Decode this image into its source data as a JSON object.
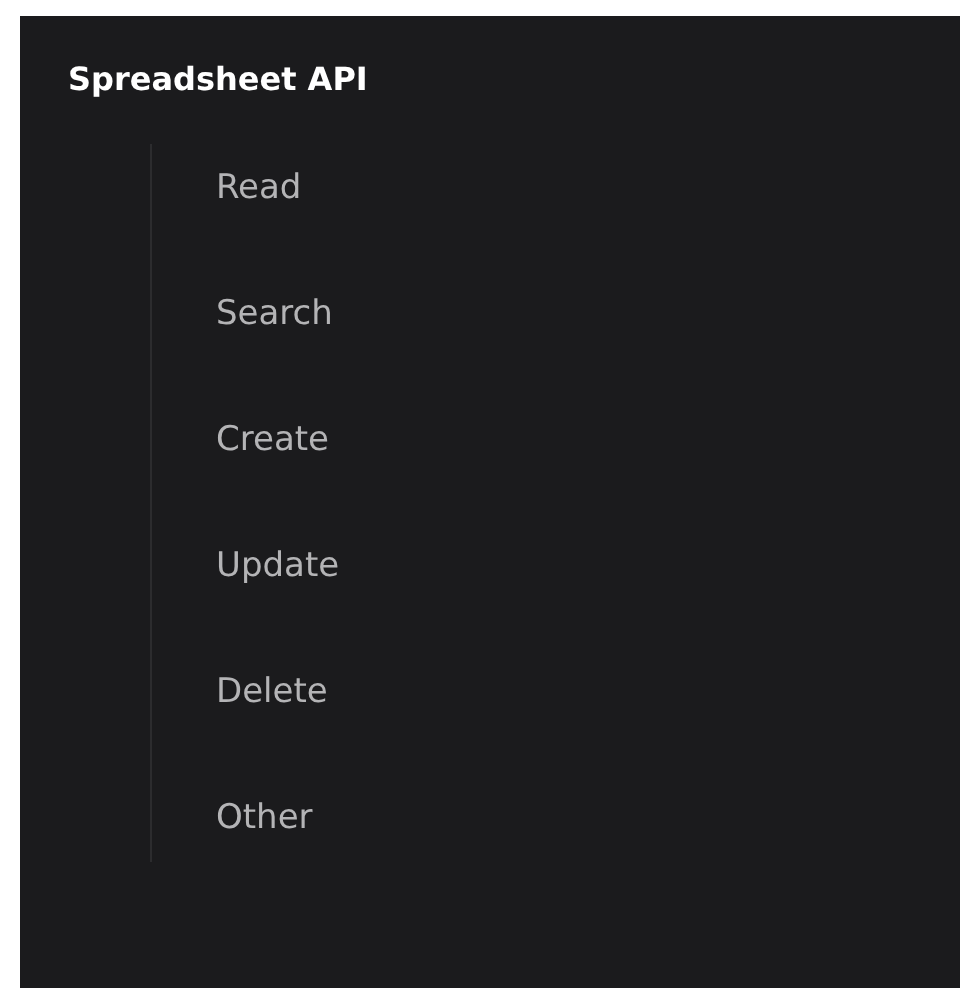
{
  "title": "Spreadsheet API",
  "items": [
    {
      "label": "Read"
    },
    {
      "label": "Search"
    },
    {
      "label": "Create"
    },
    {
      "label": "Update"
    },
    {
      "label": "Delete"
    },
    {
      "label": "Other"
    }
  ]
}
